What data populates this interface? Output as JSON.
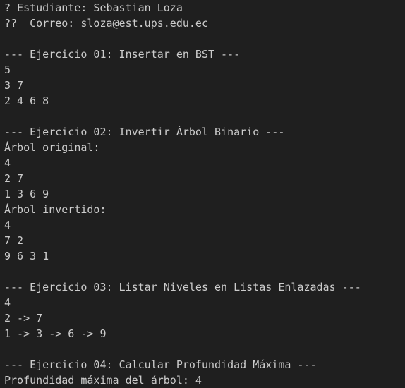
{
  "terminal": {
    "lines": [
      "? Estudiante: Sebastian Loza",
      "??  Correo: sloza@est.ups.edu.ec",
      "",
      "--- Ejercicio 01: Insertar en BST ---",
      "5",
      "3 7",
      "2 4 6 8",
      "",
      "--- Ejercicio 02: Invertir Árbol Binario ---",
      "Árbol original:",
      "4",
      "2 7",
      "1 3 6 9",
      "Árbol invertido:",
      "4",
      "7 2",
      "9 6 3 1",
      "",
      "--- Ejercicio 03: Listar Niveles en Listas Enlazadas ---",
      "4",
      "2 -> 7",
      "1 -> 3 -> 6 -> 9",
      "",
      "--- Ejercicio 04: Calcular Profundidad Máxima ---",
      "Profundidad máxima del árbol: 4"
    ]
  },
  "colors": {
    "background": "#1f1f1f",
    "text": "#cccccc"
  }
}
